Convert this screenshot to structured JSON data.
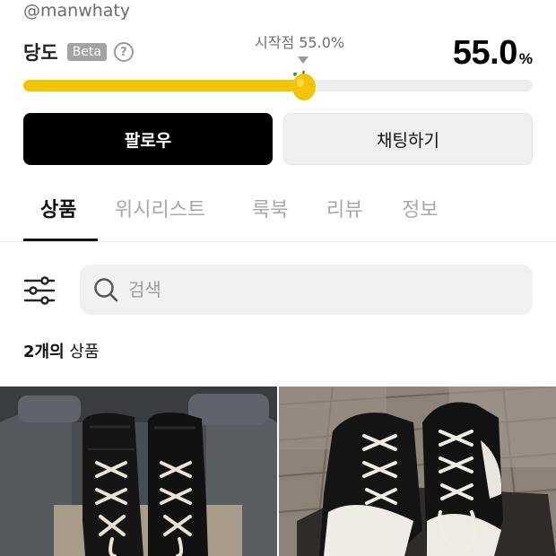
{
  "profile": {
    "handle": "@manwhaty"
  },
  "sweetness": {
    "label": "당도",
    "badge": "Beta",
    "help_icon": "question-circle-icon",
    "start_label": "시작점 55.0%",
    "value": "55.0",
    "unit": "%",
    "level_percent": 55.0,
    "bar_color": "#f5c400",
    "icon": "lemon-icon"
  },
  "actions": {
    "follow": "팔로우",
    "chat": "채팅하기"
  },
  "tabs": [
    {
      "label": "상품",
      "active": true
    },
    {
      "label": "위시리스트",
      "active": false
    },
    {
      "label": "룩북",
      "active": false
    },
    {
      "label": "리뷰",
      "active": false
    },
    {
      "label": "정보",
      "active": false
    }
  ],
  "search": {
    "placeholder": "검색",
    "icon": "search-icon",
    "filter_icon": "filter-sliders-icon"
  },
  "listing": {
    "count": "2개의",
    "suffix": " 상품"
  },
  "products": [
    {
      "image": "black-white-high-top-sneakers-photo"
    },
    {
      "image": "black-white-low-top-sneakers-photo"
    }
  ]
}
